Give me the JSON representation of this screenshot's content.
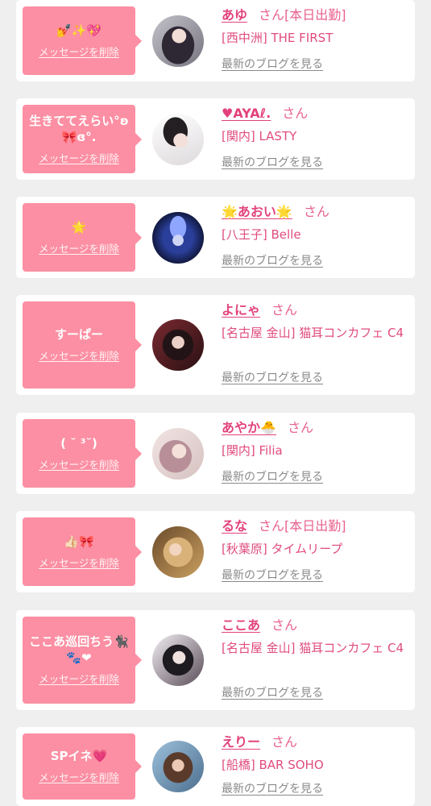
{
  "colors": {
    "page_bg": "#efefef",
    "card_bg": "#ffffff",
    "bubble": "#fc8fa3",
    "name": "#e2427b",
    "honorific": "#e8628d",
    "shop": "#e04c7e",
    "blog_link": "#8a8a8a"
  },
  "labels": {
    "honorific": "さん",
    "delete_message": "メッセージを削除",
    "latest_blog": "最新のブログを見る"
  },
  "cards": [
    {
      "message": "💅✨💖",
      "name": "あゆ",
      "status": "[本日出勤]",
      "shop": "[西中洲] THE FIRST"
    },
    {
      "message": "生きててえらい°ʚ🎀ɞ°.",
      "name": "♥AYAℓ.",
      "shop": "[関内] LASTY"
    },
    {
      "message": "🌟",
      "name": "🌟あおい🌟",
      "shop": "[八王子] Belle"
    },
    {
      "message": "すーぱー",
      "name": "よにゃ",
      "shop": "[名古屋 金山] 猫耳コンカフェ C4"
    },
    {
      "message": "( ˘ ³˘)",
      "name": "あやか🐣",
      "shop": "[関内] Filia"
    },
    {
      "message": "👍🏻🎀",
      "name": "るな",
      "status": "[本日出勤]",
      "shop": "[秋葉原] タイムリープ"
    },
    {
      "message": "ここあ巡回ちう🐈‍⬛🐾❤",
      "name": "ここあ",
      "shop": "[名古屋 金山] 猫耳コンカフェ C4"
    },
    {
      "message": "SPイネ💗",
      "name": "えりー",
      "shop": "[船橋] BAR SOHO"
    }
  ]
}
